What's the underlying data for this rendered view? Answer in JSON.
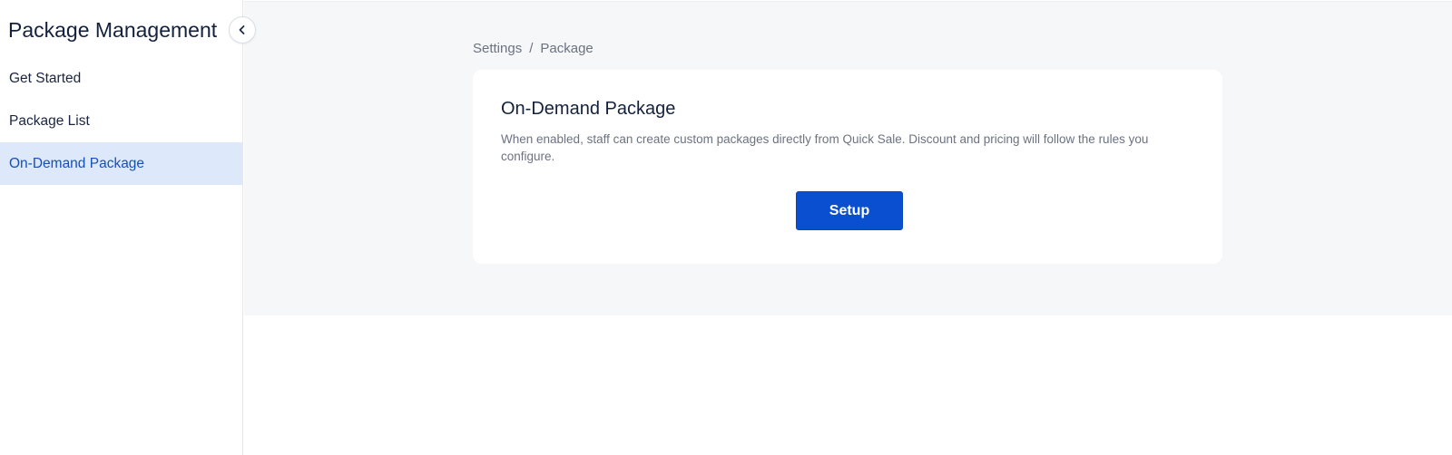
{
  "sidebar": {
    "title": "Package Management",
    "collapse_icon": "chevron-left-icon",
    "items": [
      {
        "label": "Get Started",
        "active": false
      },
      {
        "label": "Package List",
        "active": false
      },
      {
        "label": "On-Demand Package",
        "active": true
      }
    ]
  },
  "breadcrumb": {
    "items": [
      "Settings",
      "Package"
    ],
    "separator": "/"
  },
  "card": {
    "title": "On-Demand Package",
    "description": "When enabled, staff can create custom packages directly from Quick Sale. Discount and pricing will follow the rules you configure.",
    "setup_label": "Setup"
  },
  "colors": {
    "accent": "#0a4fd0",
    "active_nav_bg": "#dde9fb",
    "active_nav_text": "#1550b8",
    "main_bg": "#f6f7f9"
  }
}
